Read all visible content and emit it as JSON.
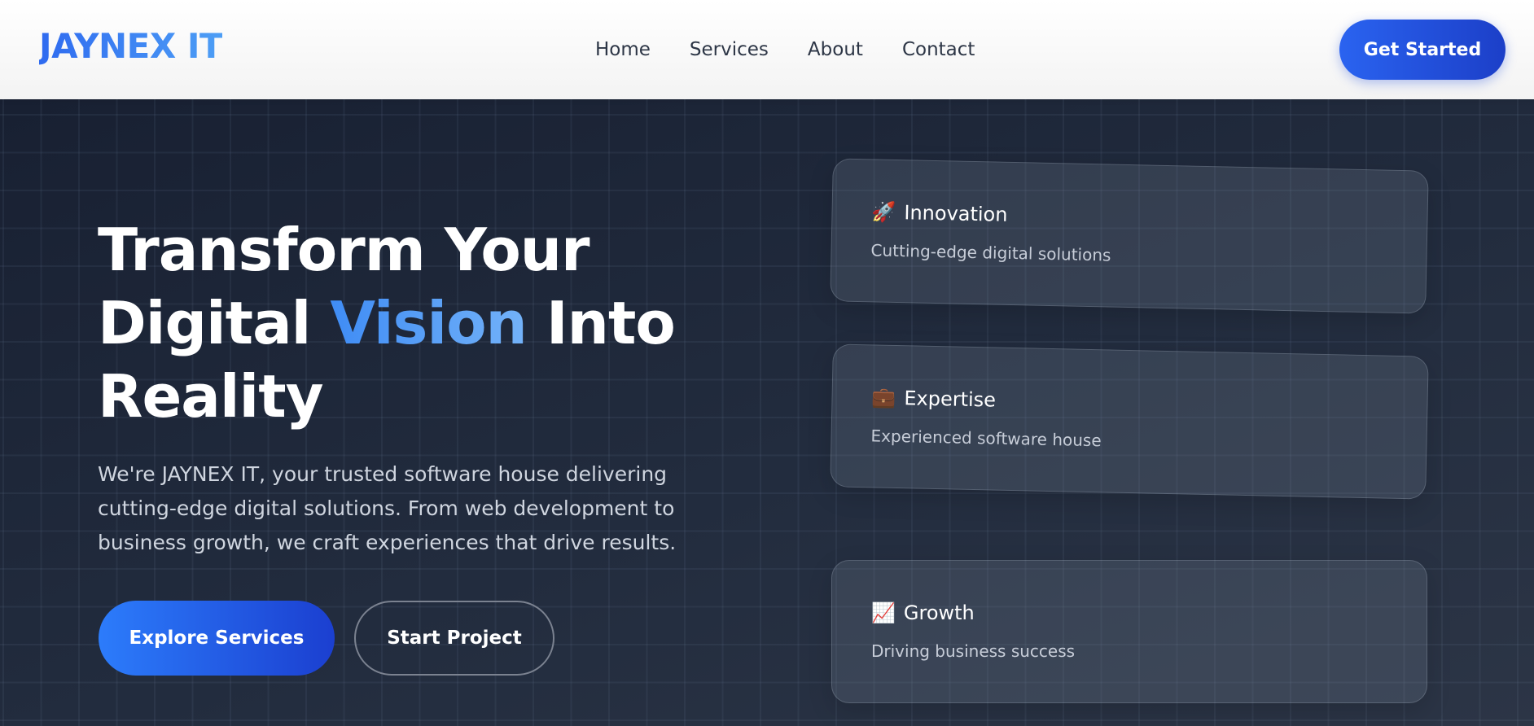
{
  "header": {
    "logo": "JAYNEX IT",
    "nav": [
      "Home",
      "Services",
      "About",
      "Contact"
    ],
    "cta": "Get Started"
  },
  "hero": {
    "title_part1": "Transform Your",
    "title_part2": "Digital ",
    "title_accent": "Vision",
    "title_part3": " Into",
    "title_part4": "Reality",
    "description": "We're JAYNEX IT, your trusted software house delivering cutting-edge digital solutions. From web development to business growth, we craft experiences that drive results.",
    "primary_button": "Explore Services",
    "secondary_button": "Start Project"
  },
  "cards": [
    {
      "icon": "rocket-icon",
      "emoji": "🚀",
      "title": "Innovation",
      "description": "Cutting-edge digital solutions"
    },
    {
      "icon": "briefcase-icon",
      "emoji": "💼",
      "title": "Expertise",
      "description": "Experienced software house"
    },
    {
      "icon": "chart-increasing-icon",
      "emoji": "📈",
      "title": "Growth",
      "description": "Driving business success"
    }
  ],
  "colors": {
    "brand_blue": "#2a63f0",
    "accent_light_blue": "#4d9ef5",
    "hero_bg": "#1c2536"
  }
}
